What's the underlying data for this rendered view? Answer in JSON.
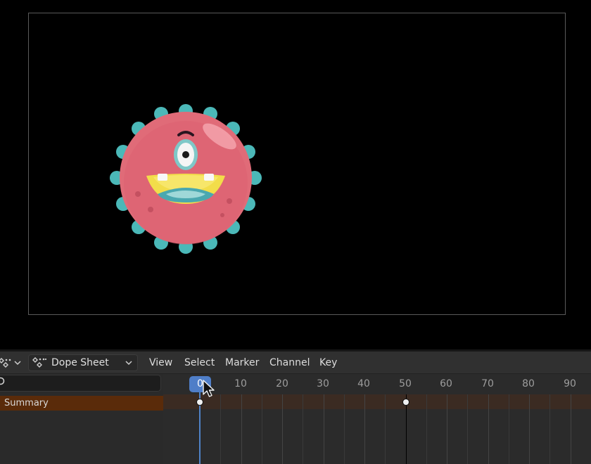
{
  "header": {
    "editor_mode": "Dope Sheet",
    "menus": [
      "View",
      "Select",
      "Marker",
      "Channel",
      "Key"
    ]
  },
  "channels": {
    "search_value": "",
    "summary_label": "Summary"
  },
  "timeline": {
    "current_frame": "0",
    "ticks": [
      "10",
      "20",
      "30",
      "40",
      "50",
      "60",
      "70",
      "80",
      "90"
    ],
    "keyframes": [
      0,
      50
    ]
  },
  "colors": {
    "playhead": "#4f83c8",
    "summary_highlight": "#5a2b0a",
    "monster_body": "#e06b78",
    "monster_spikes": "#4bb8b8"
  },
  "icons": {
    "editor_type": "dope-sheet-icon",
    "mode": "dope-sheet-icon",
    "search": "search-icon"
  }
}
